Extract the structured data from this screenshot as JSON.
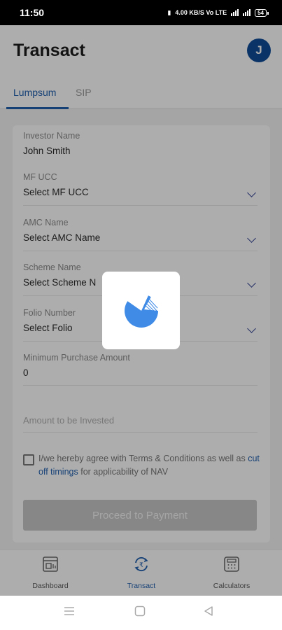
{
  "status_bar": {
    "time": "11:50",
    "indicators": "4.00 KB/S  Vo LTE",
    "battery": "54"
  },
  "header": {
    "title": "Transact",
    "avatar_initial": "J"
  },
  "tabs": [
    {
      "label": "Lumpsum",
      "active": true
    },
    {
      "label": "SIP",
      "active": false
    }
  ],
  "form": {
    "investor_name": {
      "label": "Investor Name",
      "value": "John Smith"
    },
    "mf_ucc": {
      "label": "MF UCC",
      "value": "Select MF UCC"
    },
    "amc_name": {
      "label": "AMC Name",
      "value": "Select AMC Name"
    },
    "scheme_name": {
      "label": "Scheme Name",
      "value": "Select Scheme N"
    },
    "folio_number": {
      "label": "Folio Number",
      "value": "Select Folio"
    },
    "min_purchase": {
      "label": "Minimum Purchase Amount",
      "value": "0"
    },
    "amount_invested": {
      "placeholder": "Amount to be Invested"
    },
    "terms": {
      "text_before": "I/we hereby agree with Terms & Conditions as well as ",
      "link": "cut off timings",
      "text_after": " for applicability of NAV",
      "checked": false
    },
    "proceed_label": "Proceed to Payment"
  },
  "bottom_nav": [
    {
      "label": "Dashboard",
      "icon": "dashboard-icon",
      "active": false
    },
    {
      "label": "Transact",
      "icon": "rupee-transfer-icon",
      "active": true
    },
    {
      "label": "Calculators",
      "icon": "calculator-icon",
      "active": false
    }
  ],
  "colors": {
    "accent": "#1f5fae",
    "avatar": "#0f4c99",
    "loader": "#3f8be6"
  }
}
